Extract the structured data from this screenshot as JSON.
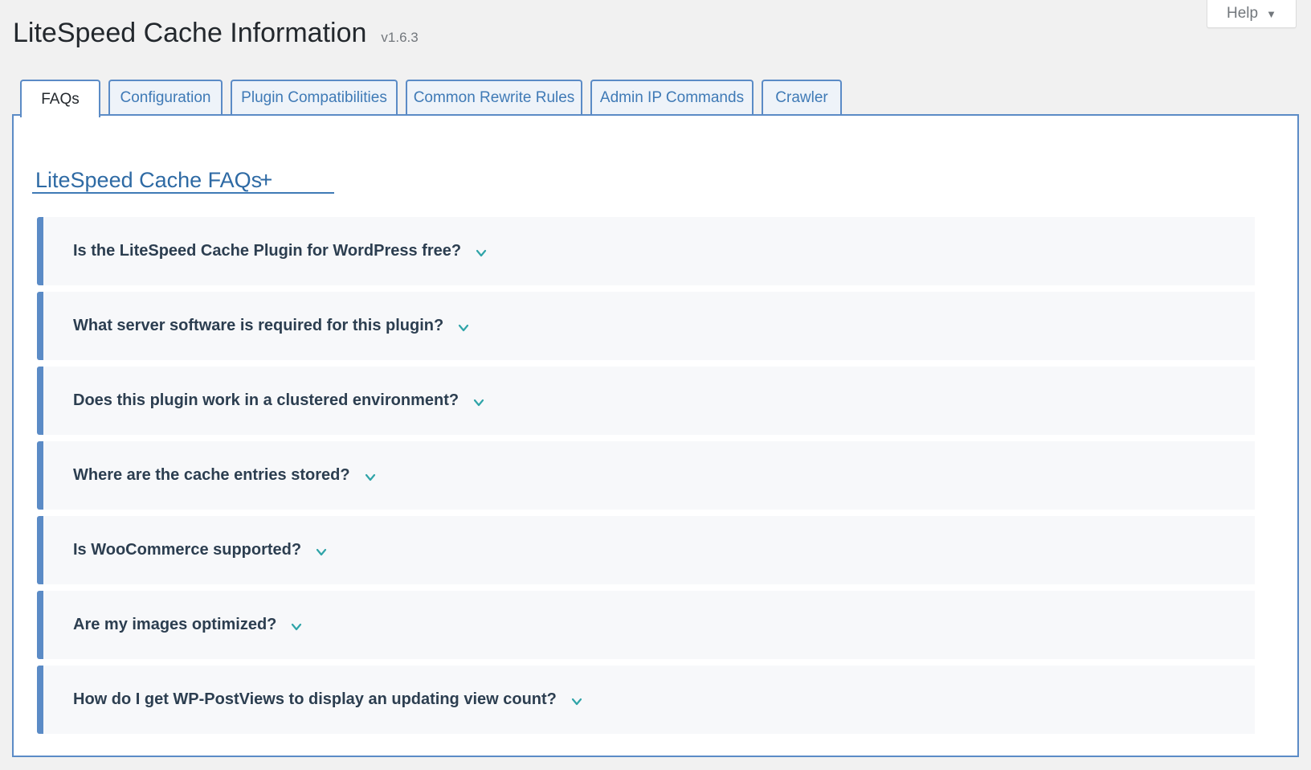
{
  "help": {
    "label": "Help",
    "arrow": "▼"
  },
  "header": {
    "title": "LiteSpeed Cache Information",
    "version": "v1.6.3"
  },
  "tabs": [
    {
      "label": "FAQs",
      "active": true
    },
    {
      "label": "Configuration",
      "active": false
    },
    {
      "label": "Plugin Compatibilities",
      "active": false
    },
    {
      "label": "Common Rewrite Rules",
      "active": false
    },
    {
      "label": "Admin IP Commands",
      "active": false
    },
    {
      "label": "Crawler",
      "active": false
    }
  ],
  "faq": {
    "heading": "LiteSpeed Cache FAQs",
    "expand_all": "+",
    "items": [
      {
        "question": "Is the LiteSpeed Cache Plugin for WordPress free?",
        "icon": "chevron-down-icon"
      },
      {
        "question": "What server software is required for this plugin?",
        "icon": "chevron-down-icon"
      },
      {
        "question": "Does this plugin work in a clustered environment?",
        "icon": "chevron-down-icon"
      },
      {
        "question": "Where are the cache entries stored?",
        "icon": "chevron-down-icon"
      },
      {
        "question": "Is WooCommerce supported?",
        "icon": "chevron-down-icon"
      },
      {
        "question": "Are my images optimized?",
        "icon": "chevron-down-icon"
      },
      {
        "question": "How do I get WP-PostViews to display an updating view count?",
        "icon": "chevron-down-icon"
      }
    ]
  },
  "colors": {
    "accent": "#5b8bc6",
    "link": "#3f7ab6",
    "chevron": "#2fa4a8",
    "background": "#f1f1f1"
  }
}
